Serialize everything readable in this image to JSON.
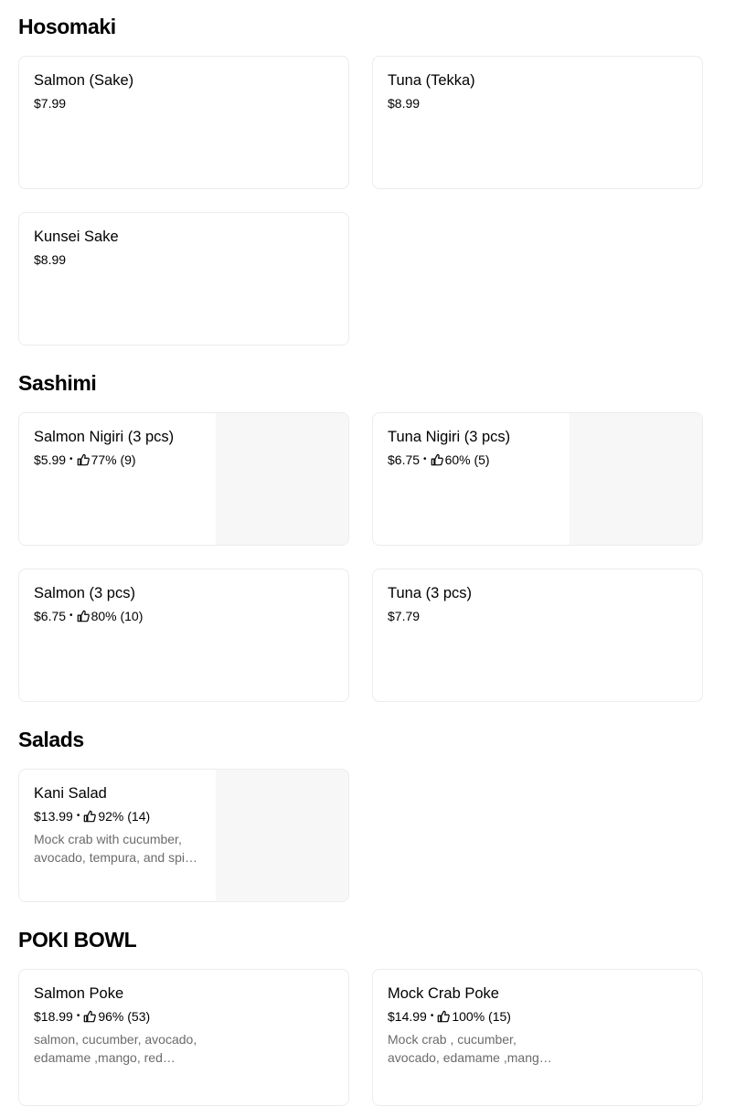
{
  "sections": [
    {
      "title": "Hosomaki",
      "items": [
        {
          "name": "Salmon (Sake)",
          "price": "$7.99"
        },
        {
          "name": "Tuna (Tekka)",
          "price": "$8.99"
        },
        {
          "name": "Kunsei Sake",
          "price": "$8.99"
        }
      ]
    },
    {
      "title": "Sashimi",
      "items": [
        {
          "name": "Salmon Nigiri (3 pcs)",
          "price": "$5.99",
          "rating": "77% (9)"
        },
        {
          "name": "Tuna Nigiri (3 pcs)",
          "price": "$6.75",
          "rating": "60% (5)"
        },
        {
          "name": "Salmon (3 pcs)",
          "price": "$6.75",
          "rating": "80% (10)"
        },
        {
          "name": "Tuna (3 pcs)",
          "price": "$7.79"
        }
      ]
    },
    {
      "title": "Salads",
      "items": [
        {
          "name": "Kani Salad",
          "price": "$13.99",
          "rating": "92% (14)",
          "description": "Mock crab with cucumber, avocado, tempura, and spi…"
        }
      ]
    },
    {
      "title": "POKI BOWL",
      "items": [
        {
          "name": "Salmon Poke",
          "price": "$18.99",
          "rating": "96% (53)",
          "description": "salmon, cucumber, avocado, edamame ,mango, red…"
        },
        {
          "name": "Mock Crab Poke",
          "price": "$14.99",
          "rating": "100% (15)",
          "description": "Mock crab , cucumber, avocado, edamame ,mang…"
        }
      ]
    }
  ],
  "separator": "•",
  "icons": {
    "rating": "thumbs-up-icon"
  },
  "colors": {
    "card_border": "#ececec",
    "image_placeholder": "#f7f7f7",
    "description_text": "#6b6b6b"
  }
}
